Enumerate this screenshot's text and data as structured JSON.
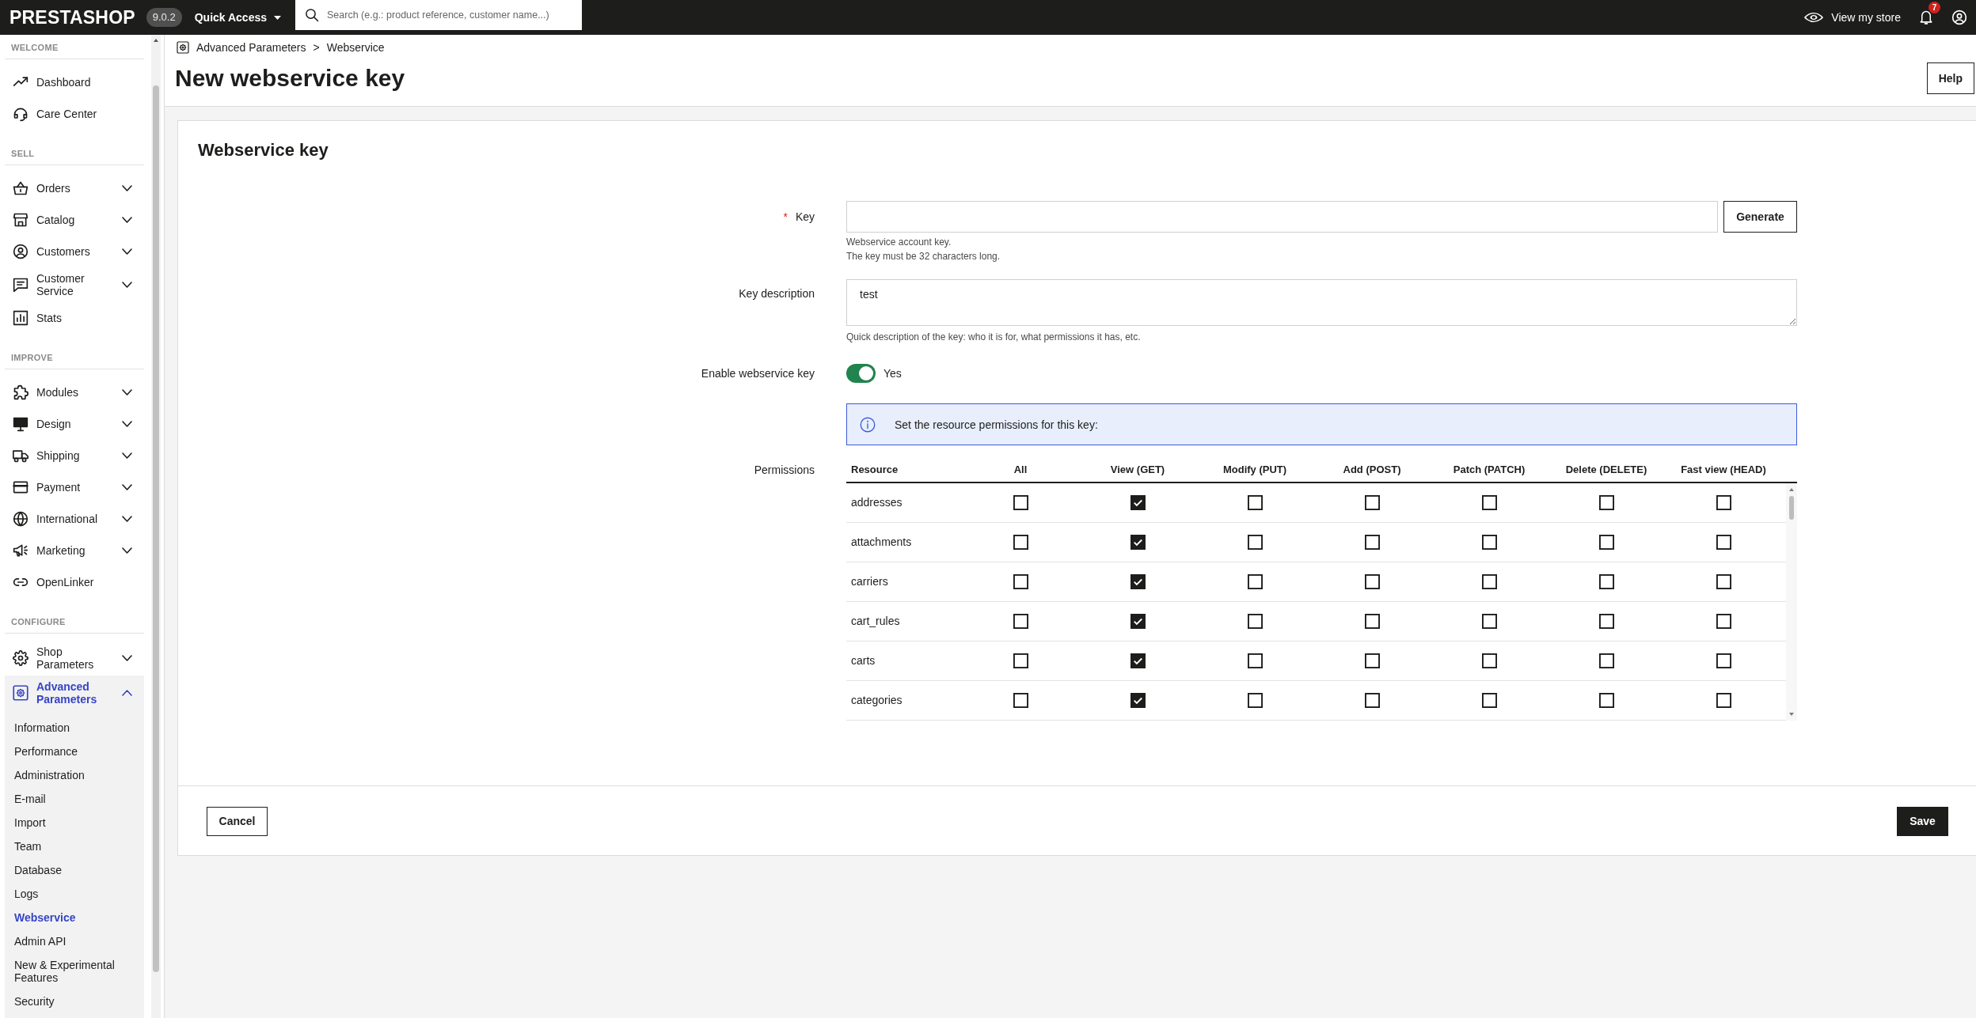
{
  "topbar": {
    "logo": "PRESTASHOP",
    "version": "9.0.2",
    "quick_access": "Quick Access",
    "search": {
      "placeholder": "Search (e.g.: product reference, customer name...)"
    },
    "view_store": "View my store",
    "notification_count": "7"
  },
  "sidebar": {
    "sections": [
      {
        "title": "WELCOME",
        "items": [
          {
            "label": "Dashboard",
            "kind": "link",
            "selected": false
          },
          {
            "label": "Care Center",
            "kind": "link",
            "selected": false
          }
        ]
      },
      {
        "title": "SELL",
        "items": [
          {
            "label": "Orders",
            "kind": "menu",
            "expanded": false,
            "selected": false
          },
          {
            "label": "Catalog",
            "kind": "menu",
            "expanded": false,
            "selected": false
          },
          {
            "label": "Customers",
            "kind": "menu",
            "expanded": false,
            "selected": false
          },
          {
            "label": "Customer Service",
            "kind": "menu",
            "expanded": false,
            "selected": false
          },
          {
            "label": "Stats",
            "kind": "link",
            "selected": false
          }
        ]
      },
      {
        "title": "IMPROVE",
        "items": [
          {
            "label": "Modules",
            "kind": "menu",
            "expanded": false,
            "selected": false
          },
          {
            "label": "Design",
            "kind": "menu",
            "expanded": false,
            "selected": false
          },
          {
            "label": "Shipping",
            "kind": "menu",
            "expanded": false,
            "selected": false
          },
          {
            "label": "Payment",
            "kind": "menu",
            "expanded": false,
            "selected": false
          },
          {
            "label": "International",
            "kind": "menu",
            "expanded": false,
            "selected": false
          },
          {
            "label": "Marketing",
            "kind": "menu",
            "expanded": false,
            "selected": false
          },
          {
            "label": "OpenLinker",
            "kind": "link",
            "selected": false
          }
        ]
      },
      {
        "title": "CONFIGURE",
        "items": [
          {
            "label": "Shop Parameters",
            "kind": "menu",
            "expanded": false,
            "selected": false
          },
          {
            "label": "Advanced Parameters",
            "kind": "menu",
            "expanded": true,
            "selected": true,
            "children": [
              {
                "label": "Information",
                "selected": false
              },
              {
                "label": "Performance",
                "selected": false
              },
              {
                "label": "Administration",
                "selected": false
              },
              {
                "label": "E-mail",
                "selected": false
              },
              {
                "label": "Import",
                "selected": false
              },
              {
                "label": "Team",
                "selected": false
              },
              {
                "label": "Database",
                "selected": false
              },
              {
                "label": "Logs",
                "selected": false
              },
              {
                "label": "Webservice",
                "selected": true
              },
              {
                "label": "Admin API",
                "selected": false
              },
              {
                "label": "New & Experimental Features",
                "selected": false
              },
              {
                "label": "Security",
                "selected": false
              }
            ]
          }
        ]
      }
    ]
  },
  "header": {
    "breadcrumb": {
      "items": [
        "Advanced Parameters",
        "Webservice"
      ],
      "separator": ">"
    },
    "title": "New webservice key",
    "help_button": "Help"
  },
  "form": {
    "title": "Webservice key",
    "key": {
      "label": "Key",
      "required_mark": "*",
      "button": "Generate",
      "help": [
        "Webservice account key.",
        "The key must be 32 characters long."
      ]
    },
    "description": {
      "label": "Key description",
      "value": "test",
      "help": "Quick description of the key: who it is for, what permissions it has, etc."
    },
    "enabled": {
      "label": "Enable webservice key",
      "on": true,
      "state_label": "Yes"
    },
    "alert": "Set the resource permissions for this key:",
    "permissions": {
      "label": "Permissions",
      "columns": [
        "Resource",
        "All",
        "View (GET)",
        "Modify (PUT)",
        "Add (POST)",
        "Patch (PATCH)",
        "Delete (DELETE)",
        "Fast view (HEAD)"
      ],
      "rows": [
        {
          "resource": "addresses",
          "checked": [
            false,
            true,
            false,
            false,
            false,
            false,
            false
          ]
        },
        {
          "resource": "attachments",
          "checked": [
            false,
            true,
            false,
            false,
            false,
            false,
            false
          ]
        },
        {
          "resource": "carriers",
          "checked": [
            false,
            true,
            false,
            false,
            false,
            false,
            false
          ]
        },
        {
          "resource": "cart_rules",
          "checked": [
            false,
            true,
            false,
            false,
            false,
            false,
            false
          ]
        },
        {
          "resource": "carts",
          "checked": [
            false,
            true,
            false,
            false,
            false,
            false,
            false
          ]
        },
        {
          "resource": "categories",
          "checked": [
            false,
            true,
            false,
            false,
            false,
            false,
            false
          ]
        }
      ]
    }
  },
  "footer": {
    "cancel": "Cancel",
    "save": "Save"
  }
}
